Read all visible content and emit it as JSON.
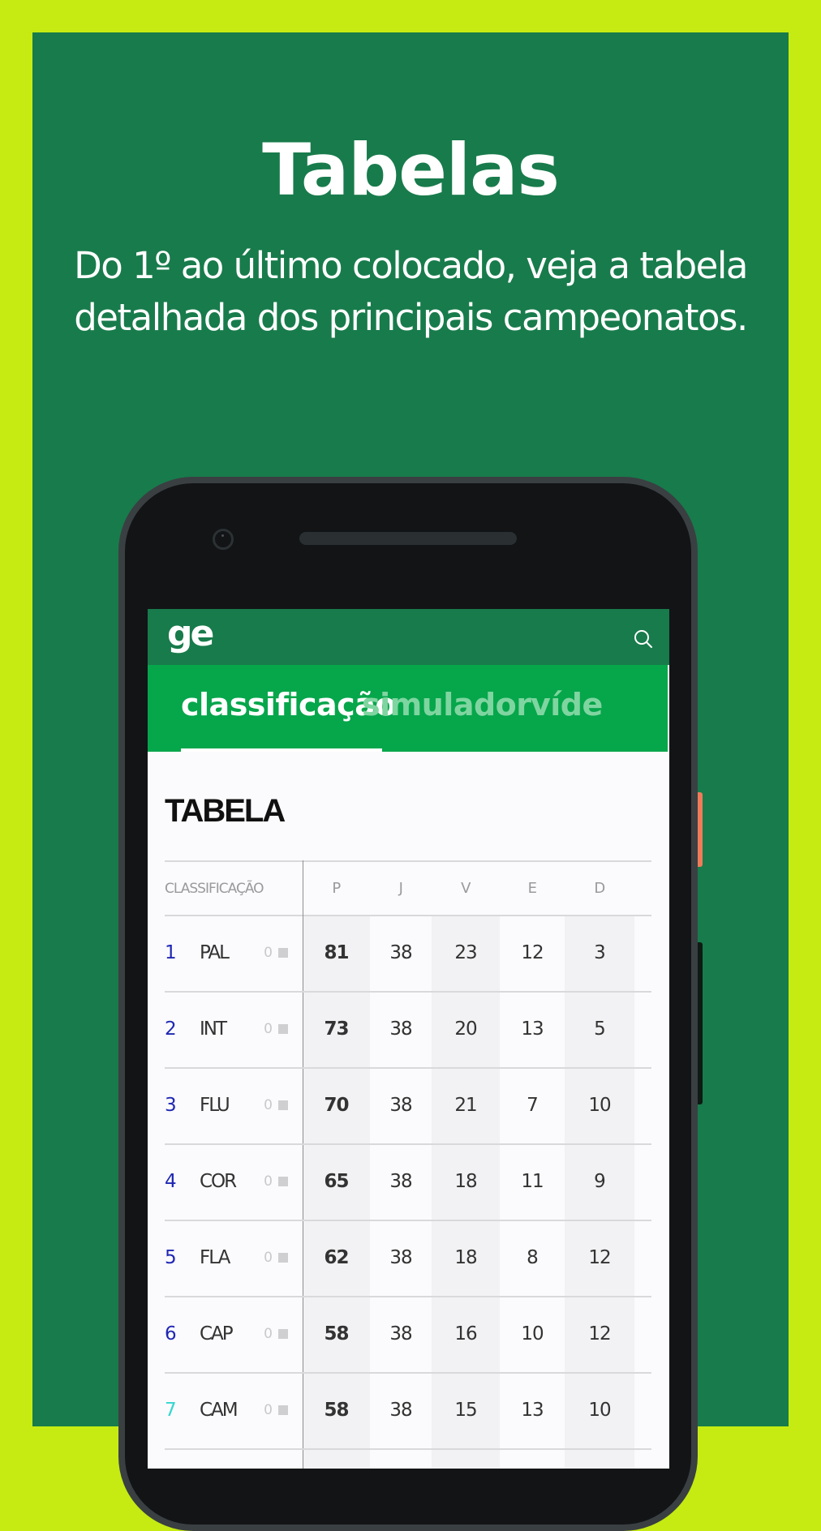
{
  "promo": {
    "title": "Tabelas",
    "subtitle_line1": "Do 1º ao último colocado, veja a tabela",
    "subtitle_line2": "detalhada dos principais campeonatos."
  },
  "colors": {
    "background_lime": "#C5EB12",
    "panel_green": "#187B4B",
    "header_green": "#187B4B",
    "tabbar_green": "#06A64B",
    "inactive_tab_text": "#7FD5A0",
    "position_blue": "#1F27B3",
    "position_cyan": "#33D6D0",
    "phone_accent_button": "#F07B5A"
  },
  "app": {
    "logo": "ge",
    "search_icon": "search-icon",
    "tabs": [
      {
        "label": "classificação",
        "active": true
      },
      {
        "label": "simulador",
        "active": false
      },
      {
        "label": "víde",
        "active": false
      }
    ],
    "section_title": "TABELA"
  },
  "table": {
    "headers": {
      "classification": "CLASSIFICAÇÃO",
      "p": "P",
      "j": "J",
      "v": "V",
      "e": "E",
      "d": "D"
    },
    "rows": [
      {
        "pos": "1",
        "team": "PAL",
        "variation": "0",
        "p": "81",
        "j": "38",
        "v": "23",
        "e": "12",
        "d": "3"
      },
      {
        "pos": "2",
        "team": "INT",
        "variation": "0",
        "p": "73",
        "j": "38",
        "v": "20",
        "e": "13",
        "d": "5"
      },
      {
        "pos": "3",
        "team": "FLU",
        "variation": "0",
        "p": "70",
        "j": "38",
        "v": "21",
        "e": "7",
        "d": "10"
      },
      {
        "pos": "4",
        "team": "COR",
        "variation": "0",
        "p": "65",
        "j": "38",
        "v": "18",
        "e": "11",
        "d": "9"
      },
      {
        "pos": "5",
        "team": "FLA",
        "variation": "0",
        "p": "62",
        "j": "38",
        "v": "18",
        "e": "8",
        "d": "12"
      },
      {
        "pos": "6",
        "team": "CAP",
        "variation": "0",
        "p": "58",
        "j": "38",
        "v": "16",
        "e": "10",
        "d": "12"
      },
      {
        "pos": "7",
        "team": "CAM",
        "variation": "0",
        "p": "58",
        "j": "38",
        "v": "15",
        "e": "13",
        "d": "10"
      }
    ]
  }
}
